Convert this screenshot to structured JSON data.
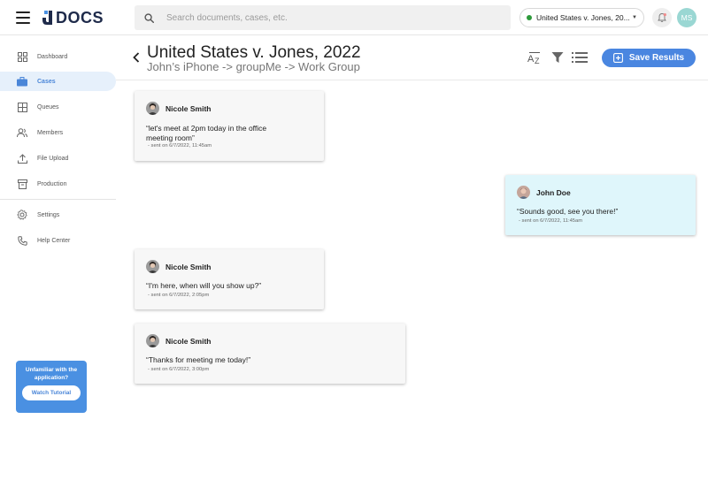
{
  "app": {
    "logo_text": "DOCS"
  },
  "search": {
    "placeholder": "Search documents, cases, etc."
  },
  "case_selector": {
    "value": "United States v. Jones, 20...",
    "status_color": "#2e9a3b"
  },
  "user": {
    "initials": "MS"
  },
  "sidebar": {
    "items": [
      {
        "label": "Dashboard",
        "icon": "dashboard-icon"
      },
      {
        "label": "Cases",
        "icon": "briefcase-icon",
        "active": true
      },
      {
        "label": "Queues",
        "icon": "queues-icon"
      },
      {
        "label": "Members",
        "icon": "members-icon"
      },
      {
        "label": "File Upload",
        "icon": "upload-icon"
      },
      {
        "label": "Production",
        "icon": "archive-icon"
      },
      {
        "label": "Settings",
        "icon": "gear-icon"
      },
      {
        "label": "Help Center",
        "icon": "phone-icon"
      }
    ],
    "tutorial": {
      "text": "Unfamiliar with the application?",
      "button": "Watch Tutorial"
    }
  },
  "header": {
    "title": "United States v. Jones, 2022",
    "subtitle": "John’s iPhone -> groupMe -> Work Group",
    "save_label": "Save Results"
  },
  "messages": [
    {
      "sender": "Nicole Smith",
      "text_lines": [
        "“let's meet at 2pm today in the office",
        "meeting room”"
      ],
      "meta": "- sent on 6/7/2022, 11:45am",
      "mine": false
    },
    {
      "sender": "John Doe",
      "text_lines": [
        "“Sounds good, see you there!”"
      ],
      "meta": "- sent on 6/7/2022, 11:45am",
      "mine": true
    },
    {
      "sender": "Nicole Smith",
      "text_lines": [
        "“I'm here, when will you show up?”"
      ],
      "meta": "- sent on 6/7/2022, 2:05pm",
      "mine": false
    },
    {
      "sender": "Nicole Smith",
      "text_lines": [
        "“Thanks for meeting me today!”"
      ],
      "meta": "- sent on 6/7/2022, 3:00pm",
      "mine": false
    }
  ],
  "colors": {
    "accent": "#4a86e0",
    "active_nav_bg": "#e6f0fb",
    "mine_bubble": "#dff6fb"
  }
}
